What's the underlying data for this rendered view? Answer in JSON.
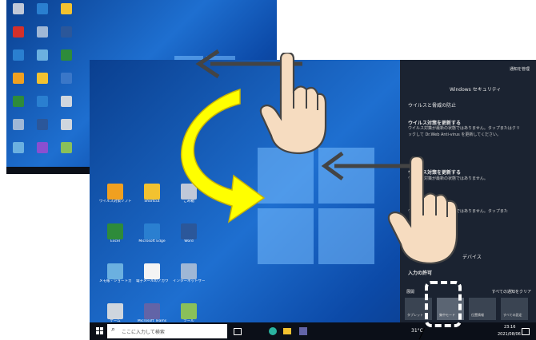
{
  "front": {
    "taskbar": {
      "search_placeholder": "ここに入力して検索",
      "temperature": "31°C",
      "time": "23:16",
      "date": "2021/08/06"
    },
    "desktop_icons": [
      {
        "label": "ウイルス対策ソフト"
      },
      {
        "label": "Shortcut"
      },
      {
        "label": "ごみ箱"
      },
      {
        "label": "Excel"
      },
      {
        "label": "Microsoft Edge"
      },
      {
        "label": "Word"
      },
      {
        "label": "メモ帳 - ショートカット"
      },
      {
        "label": "電子メールのアカウント"
      },
      {
        "label": "インターネットサービス"
      },
      {
        "label": "ゲーム"
      },
      {
        "label": "Microsoft Teams"
      },
      {
        "label": "ツール"
      }
    ],
    "action_center": {
      "manage_notifications": "通知を管理",
      "app_title": "Windows セキュリティ",
      "section_title": "ウイルスと脅威の防止",
      "notif1_title": "ウイルス対策を更新する",
      "notif1_body": "ウイルス対策が最新の状態ではありません。タップまたはクリックして Dr.Web Anti-virus を更新してください。",
      "notif2_title": "ウイルス対策を更新する",
      "notif2_body": "ウイルス対策が最新の状態ではありません。",
      "notif3_body": "ウイルス対策が最新の状態ではありません。タップまた",
      "link1": "デバイス",
      "input_title": "入力の許可",
      "expand_label": "展開",
      "collapse_label": "すべての通知をクリア",
      "tiles": [
        {
          "label": "タブレット"
        },
        {
          "label": "集中モード"
        },
        {
          "label": "位置情報"
        },
        {
          "label": "すべての設定"
        }
      ]
    }
  },
  "back": {
    "desktop_icons": [
      {
        "label": ""
      },
      {
        "label": ""
      },
      {
        "label": ""
      },
      {
        "label": ""
      },
      {
        "label": ""
      },
      {
        "label": ""
      },
      {
        "label": ""
      },
      {
        "label": ""
      },
      {
        "label": ""
      },
      {
        "label": ""
      },
      {
        "label": ""
      },
      {
        "label": ""
      },
      {
        "label": ""
      },
      {
        "label": ""
      },
      {
        "label": ""
      },
      {
        "label": ""
      },
      {
        "label": ""
      },
      {
        "label": ""
      },
      {
        "label": ""
      },
      {
        "label": ""
      },
      {
        "label": ""
      }
    ]
  },
  "colors": {
    "arrow_fill": "#ffff00",
    "arrow_edge": "#c9b400",
    "hand_fill": "#f6dcc0"
  }
}
